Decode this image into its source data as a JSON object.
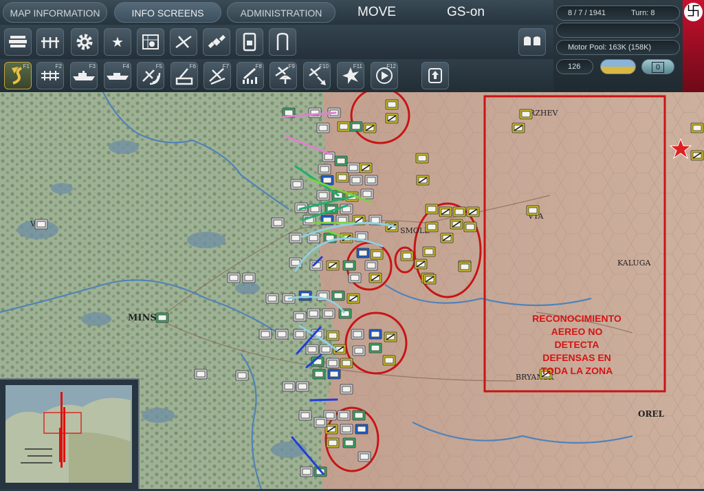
{
  "tabs": {
    "map_information": "MAP INFORMATION",
    "info_screens": "INFO SCREENS",
    "administration": "ADMINISTRATION"
  },
  "mode": {
    "phase": "MOVE",
    "gs": "GS-on"
  },
  "status": {
    "date": "8 / 7 / 1941",
    "turn": "Turn: 8",
    "motor_pool": "Motor Pool:  163K (158K)",
    "admin_points": "126",
    "counter": "0"
  },
  "toolbar1": {
    "icons": [
      "production-icon",
      "unit-list-icon",
      "gear-icon",
      "star-icon",
      "city-icon",
      "air-group-icon",
      "satellite-icon",
      "document-icon",
      "door-icon",
      "database-icon"
    ]
  },
  "toolbar2": {
    "fkeys": [
      "F1",
      "F2",
      "F3",
      "F4",
      "F5",
      "F6",
      "F7",
      "F8",
      "F9",
      "F10",
      "F11",
      "F12"
    ],
    "icons": [
      "move-icon",
      "rail-icon",
      "naval-transport-icon",
      "naval-icon",
      "air-recon-icon",
      "artillery-icon",
      "air-transfer-icon",
      "air-strike-icon",
      "paradrop-icon",
      "bomb-icon",
      "explosion-icon",
      "next-icon",
      "upload-icon"
    ]
  },
  "map_labels": {
    "minsk": "MINSK",
    "smolensk": "SMOLE",
    "vyazma": "VYA",
    "kaluga": "KALUGA",
    "bryansk": "BRYANSK",
    "orel": "OREL",
    "rzhev": "RZHEV",
    "vitebsk": "VIT"
  },
  "annotation": {
    "line1": "RECONOCIMIENTO",
    "line2": "AEREO NO",
    "line3": "DETECTA",
    "line4": "DEFENSAS EN",
    "line5": "TODA LA ZONA"
  },
  "colors": {
    "annotation_red": "#c81414",
    "german_unit": "#f0f0e0",
    "soviet_unit": "#c8b828",
    "map_green": "#8fa880",
    "map_tan": "#c8a890"
  }
}
